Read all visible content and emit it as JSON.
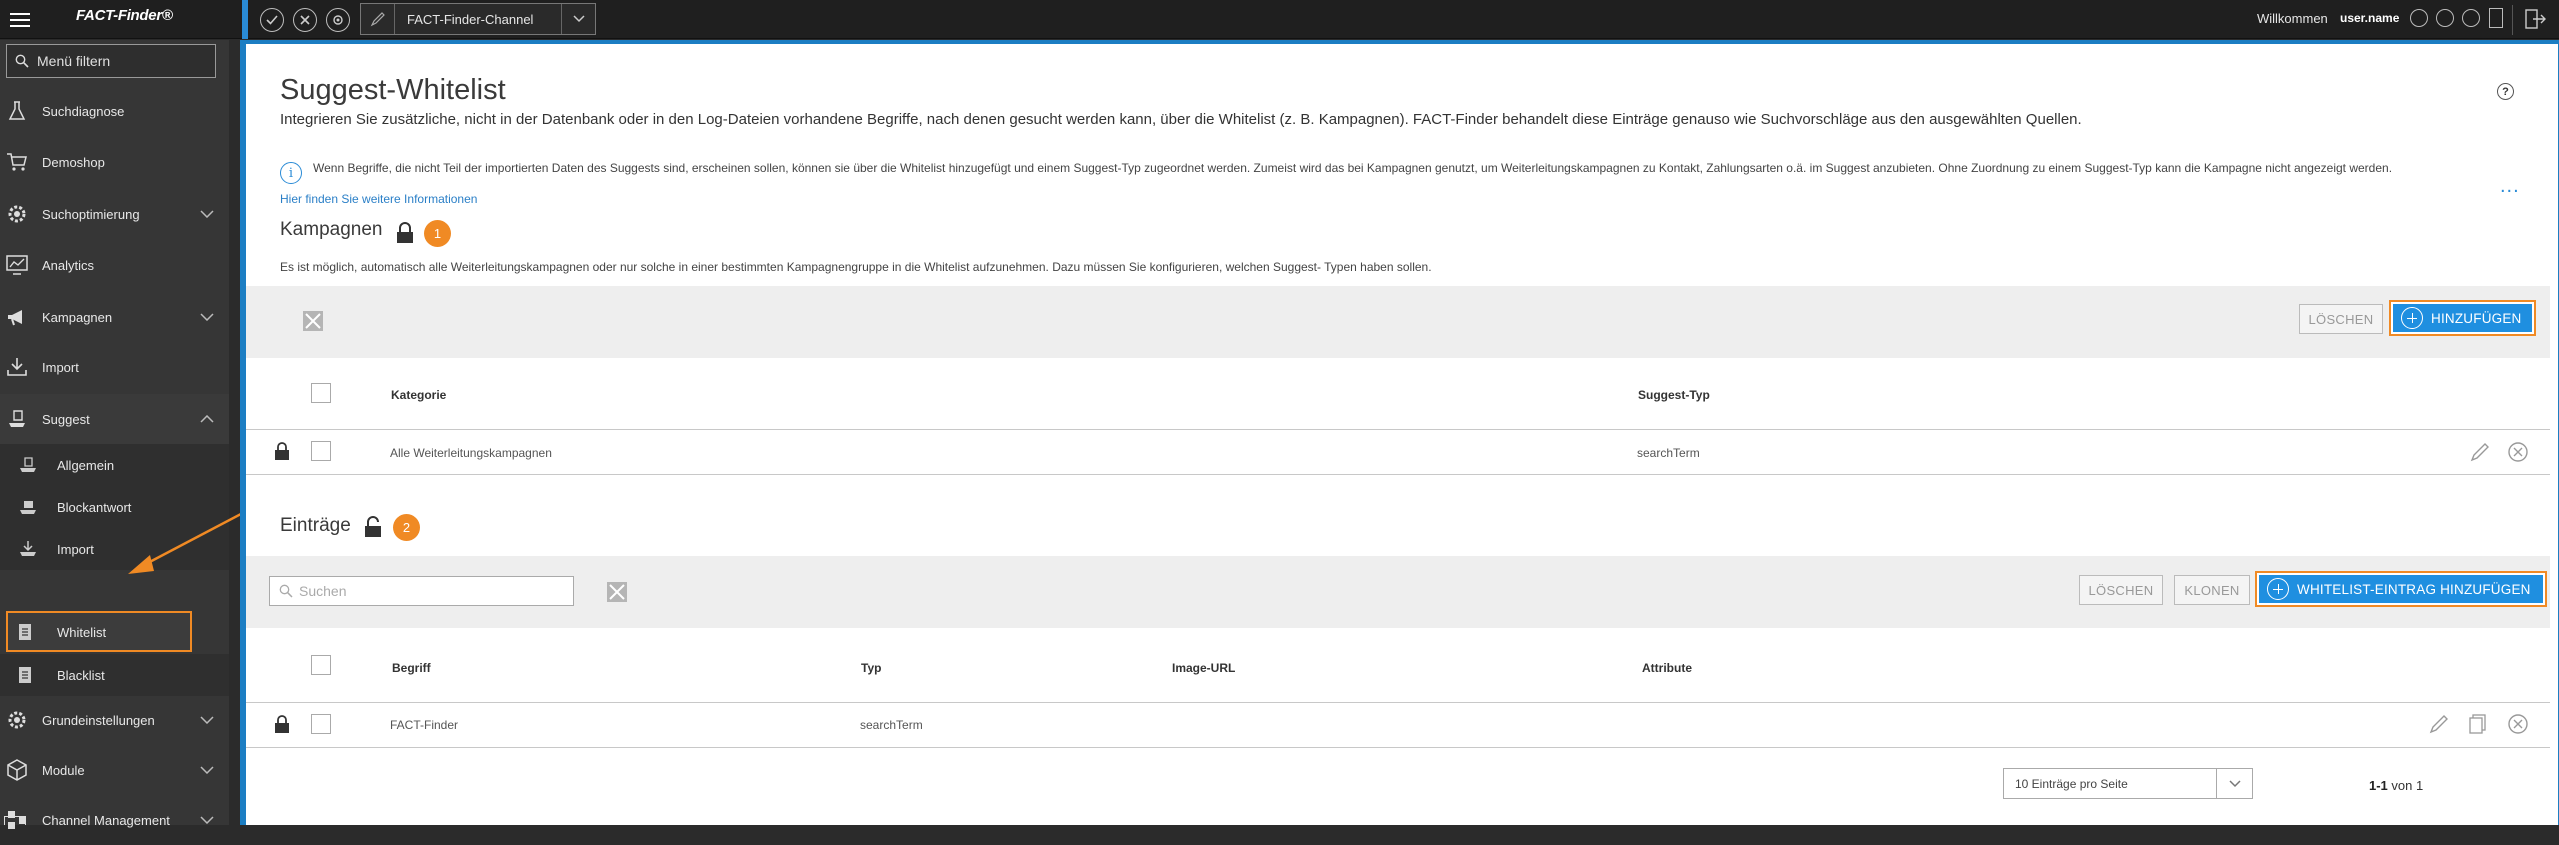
{
  "topbar": {
    "logo": "FACT-Finder®",
    "channel": "FACT-Finder-Channel",
    "welcome": "Willkommen",
    "username": "user.name"
  },
  "sidebar": {
    "filter_placeholder": "Menü filtern",
    "items": [
      {
        "label": "Suchdiagnose"
      },
      {
        "label": "Demoshop"
      },
      {
        "label": "Suchoptimierung"
      },
      {
        "label": "Analytics"
      },
      {
        "label": "Kampagnen"
      },
      {
        "label": "Import"
      },
      {
        "label": "Suggest"
      },
      {
        "label": "Grundeinstellungen"
      },
      {
        "label": "Module"
      },
      {
        "label": "Channel Management"
      }
    ],
    "suggest_sub": [
      {
        "label": "Allgemein"
      },
      {
        "label": "Blockantwort"
      },
      {
        "label": "Import"
      },
      {
        "label": "Whitelist"
      },
      {
        "label": "Blacklist"
      }
    ]
  },
  "page": {
    "title": "Suggest-Whitelist",
    "subtitle": "Integrieren Sie zusätzliche, nicht in der Datenbank oder in den Log-Dateien vorhandene Begriffe, nach denen gesucht werden kann, über die Whitelist (z. B. Kampagnen). FACT-Finder behandelt diese Einträge genauso wie Suchvorschläge aus den ausgewählten Quellen.",
    "help": "?",
    "info_text": "Wenn Begriffe, die nicht Teil der importierten Daten des Suggests sind, erscheinen sollen, können sie über die Whitelist hinzugefügt und einem Suggest-Typ zugeordnet werden. Zumeist wird das bei Kampagnen genutzt, um Weiterleitungskampagnen zu Kontakt, Zahlungsarten o.ä. im Suggest anzubieten. Ohne Zuordnung zu einem Suggest-Typ kann die Kampagne nicht angezeigt werden.",
    "info_link": "Hier finden Sie weitere Informationen",
    "info_more": "..."
  },
  "kampagnen": {
    "title": "Kampagnen",
    "badge": "1",
    "desc": "Es ist möglich, automatisch alle Weiterleitungskampagnen oder nur solche in einer bestimmten Kampagnengruppe in die Whitelist aufzunehmen. Dazu müssen Sie konfigurieren, welchen Suggest- Typen haben sollen.",
    "delete_label": "LÖSCHEN",
    "add_label": "HINZUFÜGEN",
    "columns": [
      "Kategorie",
      "Suggest-Typ"
    ],
    "rows": [
      {
        "kategorie": "Alle Weiterleitungskampagnen",
        "typ": "searchTerm"
      }
    ]
  },
  "eintraege": {
    "title": "Einträge",
    "badge": "2",
    "search_placeholder": "Suchen",
    "delete_label": "LÖSCHEN",
    "clone_label": "KLONEN",
    "add_label": "WHITELIST-EINTRAG HINZUFÜGEN",
    "columns": [
      "Begriff",
      "Typ",
      "Image-URL",
      "Attribute"
    ],
    "rows": [
      {
        "begriff": "FACT-Finder",
        "typ": "searchTerm",
        "image_url": "",
        "attribute": ""
      }
    ],
    "pager": {
      "per_page": "10 Einträge pro Seite",
      "range": "1-1",
      "of": "von 1"
    }
  },
  "colors": {
    "accent": "#1f8fe0",
    "highlight": "#f08a24",
    "sidebar": "#363636",
    "topbar": "#1f1f1f"
  }
}
